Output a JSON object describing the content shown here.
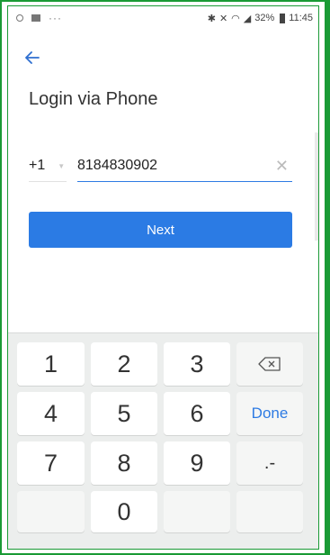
{
  "status_bar": {
    "battery": "32%",
    "time": "11:45",
    "dots": "···"
  },
  "page": {
    "title": "Login via Phone"
  },
  "country": {
    "code": "+1"
  },
  "phone": {
    "value": "8184830902"
  },
  "next_button": {
    "label": "Next"
  },
  "keyboard": {
    "keys": [
      "1",
      "2",
      "3",
      "4",
      "5",
      "6",
      "7",
      "8",
      "9",
      "0"
    ],
    "done_label": "Done",
    "symbol_label": ".-"
  }
}
